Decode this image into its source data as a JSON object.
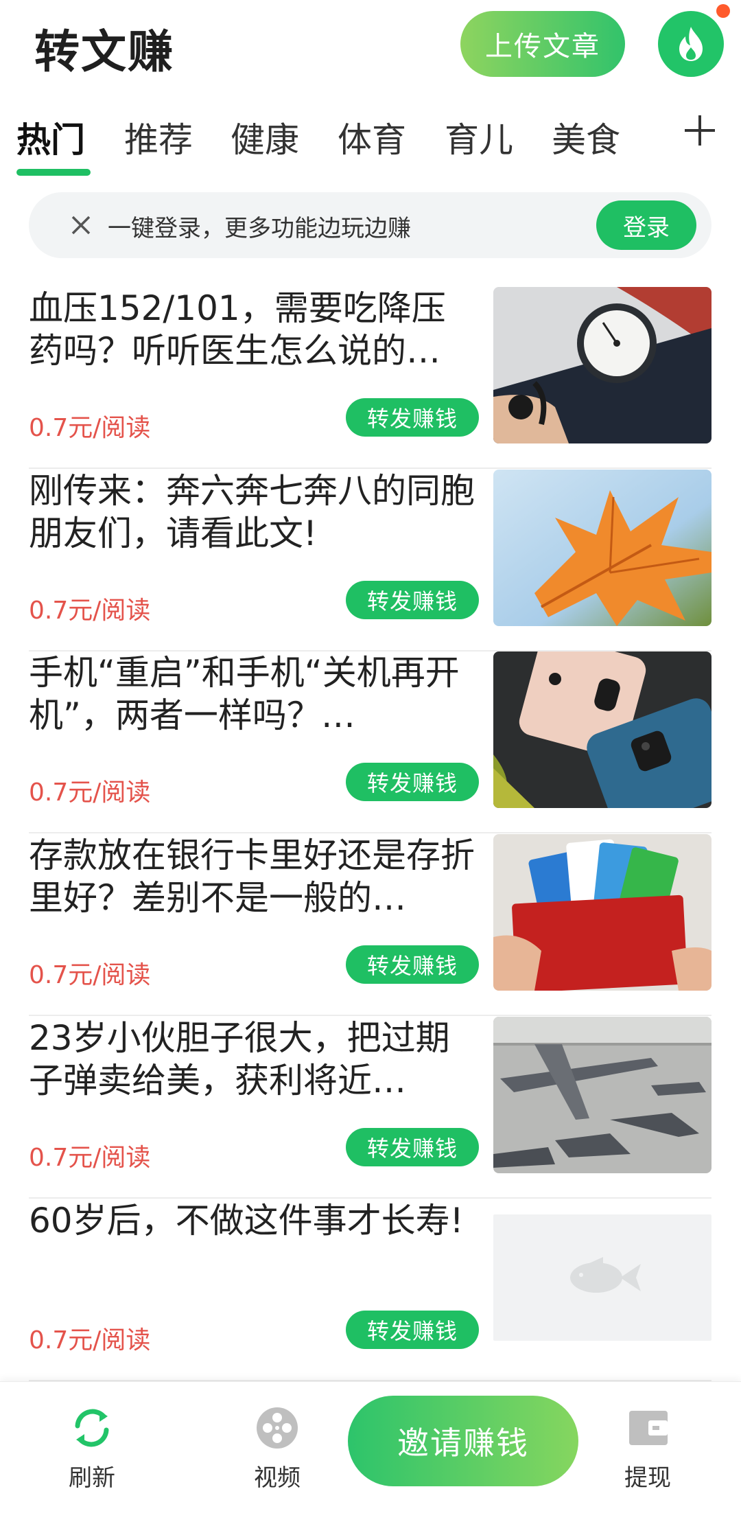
{
  "header": {
    "app_title": "转文赚",
    "upload_label": "上传文章"
  },
  "tabs": [
    {
      "label": "热门",
      "active": true
    },
    {
      "label": "推荐"
    },
    {
      "label": "健康"
    },
    {
      "label": "体育"
    },
    {
      "label": "育儿"
    },
    {
      "label": "美食"
    }
  ],
  "login_banner": {
    "text": "一键登录，更多功能边玩边赚",
    "login_label": "登录"
  },
  "articles": [
    {
      "title": "血压152/101，需要吃降压药吗？听听医生怎么说的…",
      "price": "0.7元/阅读",
      "share_label": "转发赚钱",
      "image": "blood-pressure-gauge"
    },
    {
      "title": "刚传来：奔六奔七奔八的同胞朋友们，请看此文!",
      "price": "0.7元/阅读",
      "share_label": "转发赚钱",
      "image": "maple-leaf"
    },
    {
      "title": "手机“重启”和手机“关机再开机”，两者一样吗？…",
      "price": "0.7元/阅读",
      "share_label": "转发赚钱",
      "image": "smartphones"
    },
    {
      "title": "存款放在银行卡里好还是存折里好？差别不是一般的…",
      "price": "0.7元/阅读",
      "share_label": "转发赚钱",
      "image": "bank-cards-passbook"
    },
    {
      "title": "23岁小伙胆子很大，把过期子弹卖给美，获利将近…",
      "price": "0.7元/阅读",
      "share_label": "转发赚钱",
      "image": "military-aircraft"
    },
    {
      "title": "60岁后，不做这件事才长寿!",
      "price": "0.7元/阅读",
      "share_label": "转发赚钱",
      "image": "placeholder-fish"
    }
  ],
  "bottom_nav": {
    "refresh_label": "刷新",
    "video_label": "视频",
    "invite_label": "邀请赚钱",
    "withdraw_label": "提现"
  },
  "colors": {
    "accent_green": "#1fbf63",
    "price_red": "#e4534b",
    "notification_dot": "#ff5a2c"
  }
}
